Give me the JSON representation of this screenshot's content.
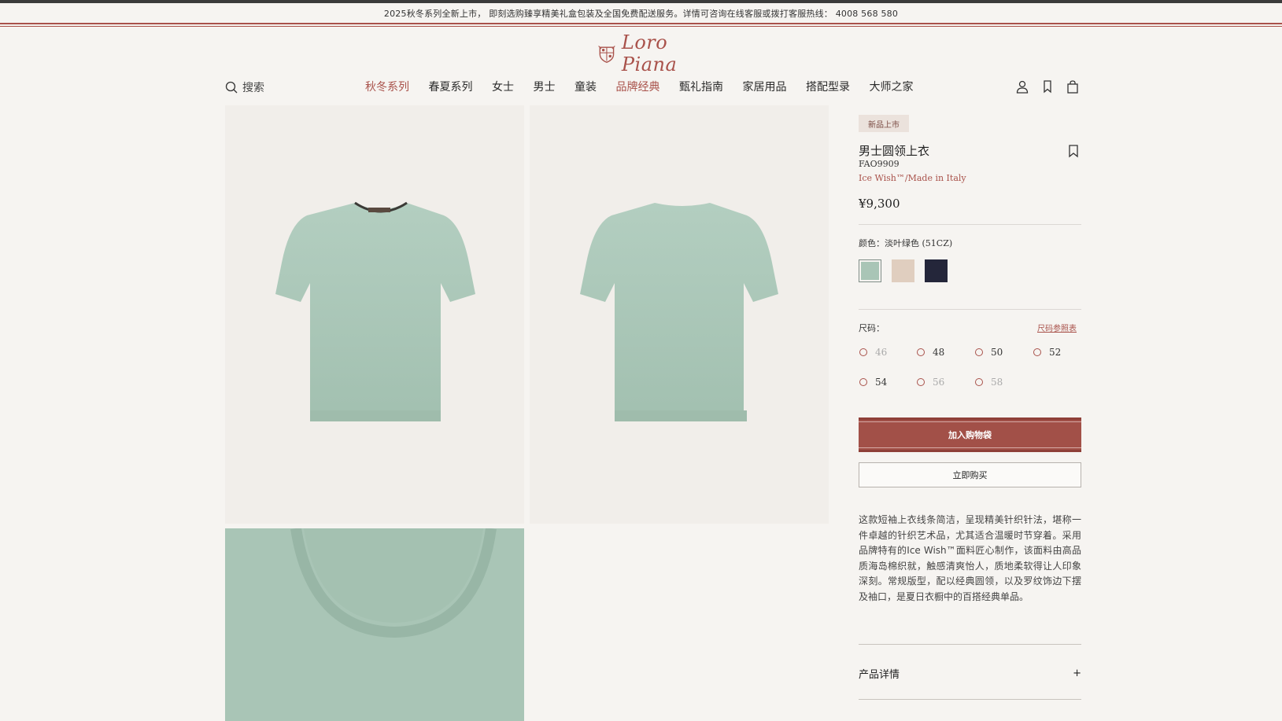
{
  "announcement": "2025秋冬系列全新上市， 即刻选购臻享精美礼盒包装及全国免费配送服务。详情可咨询在线客服或拨打客服热线： 4008 568 580",
  "logo": {
    "text": "Loro Piana"
  },
  "search": {
    "label": "搜索"
  },
  "nav": [
    "秋冬系列",
    "春夏系列",
    "女士",
    "男士",
    "童装",
    "品牌经典",
    "甄礼指南",
    "家居用品",
    "搭配型录",
    "大师之家"
  ],
  "header_icons": [
    "account-icon",
    "wishlist-icon",
    "shopping-bag-icon"
  ],
  "product": {
    "badge": "新品上市",
    "title": "男士圆领上衣",
    "code": "FAO9909",
    "subtitle": "Ice Wish™/Made in Italy",
    "price": "¥9,300",
    "color_label": "颜色：",
    "color_name": "淡叶绿色",
    "color_code": "(51CZ)",
    "swatches": [
      "#a9c5b6",
      "#e0cebf",
      "#24263a"
    ],
    "size_label": "尺码：",
    "size_guide": "尺码参照表",
    "sizes": [
      {
        "label": "46",
        "available": false
      },
      {
        "label": "48",
        "available": true
      },
      {
        "label": "50",
        "available": true
      },
      {
        "label": "52",
        "available": true
      },
      {
        "label": "54",
        "available": true
      },
      {
        "label": "56",
        "available": false
      },
      {
        "label": "58",
        "available": false
      }
    ],
    "add_to_bag": "加入购物袋",
    "buy_now": "立即购买",
    "description": "这款短袖上衣线条简洁，呈现精美针织针法，堪称一件卓越的针织艺术品，尤其适合温暖时节穿着。采用品牌特有的Ice Wish™面料匠心制作，该面料由高品质海岛棉织就，触感清爽怡人，质地柔软得让人印象深刻。常规版型，配以经典圆领，以及罗纹饰边下摆及袖口，是夏日衣橱中的百搭经典单品。",
    "details_label": "产品详情",
    "details_toggle": "+"
  },
  "colors": {
    "accent": "#a9524b",
    "sage": "#a9c5b6",
    "background": "#f6f4f1"
  }
}
